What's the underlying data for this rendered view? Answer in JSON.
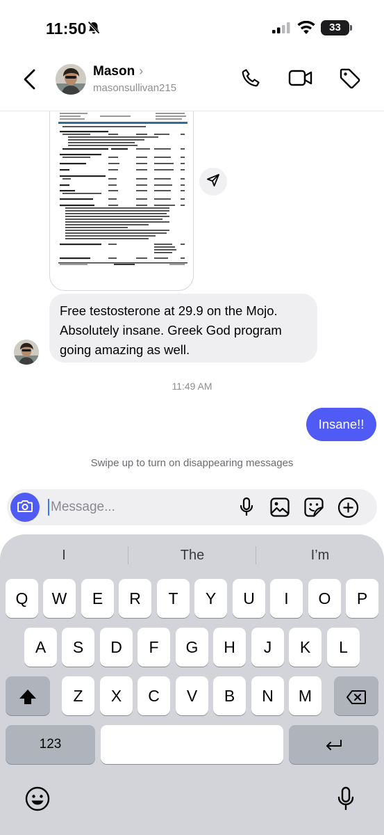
{
  "status_bar": {
    "time": "11:50",
    "battery": "33",
    "icons": [
      "bell-slash-icon",
      "cellular-signal-icon",
      "wifi-icon",
      "battery-icon"
    ]
  },
  "header": {
    "name": "Mason",
    "name_chevron": "›",
    "username": "masonsullivan215",
    "icons": [
      "back-chevron-icon",
      "phone-icon",
      "video-camera-icon",
      "tag-icon"
    ]
  },
  "messages": {
    "incoming_text": "Free testosterone at 29.9 on the Mojo. Absolutely insane. Greek God program going amazing as well.",
    "timestamp": "11:49 AM",
    "outgoing_text": "Insane!!",
    "disappearing_hint": "Swipe up to turn on disappearing messages"
  },
  "composer": {
    "placeholder": "Message...",
    "icons": [
      "camera-icon",
      "microphone-icon",
      "image-icon",
      "sticker-icon",
      "plus-circle-icon"
    ]
  },
  "keyboard": {
    "suggestions": [
      "I",
      "The",
      "I’m"
    ],
    "row1": [
      "Q",
      "W",
      "E",
      "R",
      "T",
      "Y",
      "U",
      "I",
      "O",
      "P"
    ],
    "row2": [
      "A",
      "S",
      "D",
      "F",
      "G",
      "H",
      "J",
      "K",
      "L"
    ],
    "row3": [
      "Z",
      "X",
      "C",
      "V",
      "B",
      "N",
      "M"
    ],
    "numbers_label": "123",
    "icons": [
      "shift-icon",
      "delete-icon",
      "return-icon",
      "emoji-icon",
      "dictation-mic-icon"
    ]
  },
  "colors": {
    "accent": "#4f5bf4",
    "bubble_incoming": "#efeff2",
    "keyboard_bg": "#d2d4da"
  }
}
